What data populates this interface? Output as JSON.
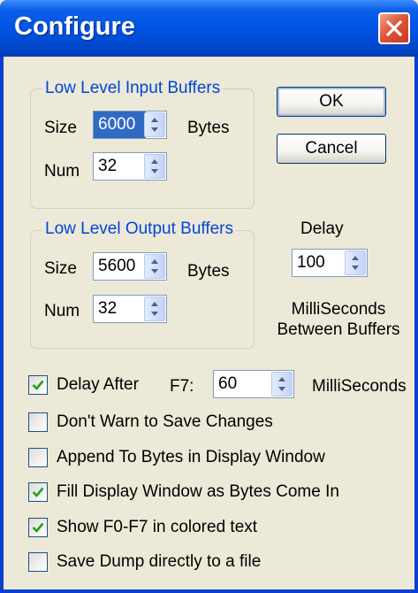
{
  "window": {
    "title": "Configure"
  },
  "input_buffers": {
    "legend": "Low Level Input Buffers",
    "size_label": "Size",
    "size_value": "6000",
    "size_units": "Bytes",
    "num_label": "Num",
    "num_value": "32"
  },
  "output_buffers": {
    "legend": "Low Level Output Buffers",
    "size_label": "Size",
    "size_value": "5600",
    "size_units": "Bytes",
    "num_label": "Num",
    "num_value": "32"
  },
  "buttons": {
    "ok": "OK",
    "cancel": "Cancel"
  },
  "delay": {
    "label": "Delay",
    "value": "100",
    "units_line1": "MilliSeconds",
    "units_line2": "Between Buffers"
  },
  "delay_after": {
    "label": "Delay After",
    "key": "F7:",
    "value": "60",
    "units": "MilliSeconds",
    "checked": true
  },
  "options": [
    {
      "label": "Don't Warn to Save Changes",
      "checked": false
    },
    {
      "label": "Append To Bytes in Display Window",
      "checked": false
    },
    {
      "label": "Fill Display Window as Bytes Come In",
      "checked": true
    },
    {
      "label": "Show F0-F7 in colored text",
      "checked": true
    },
    {
      "label": "Save Dump directly to a file",
      "checked": false
    }
  ],
  "colors": {
    "title_bar": "#0054e3",
    "dialog_bg": "#ece9d8",
    "legend": "#0046d5",
    "check": "#21a121",
    "close": "#e0563a"
  }
}
